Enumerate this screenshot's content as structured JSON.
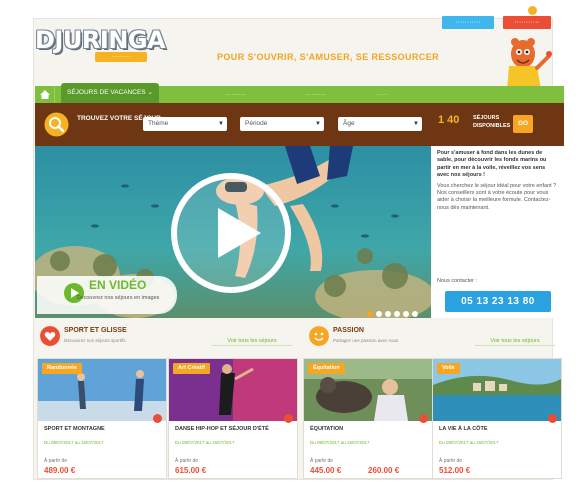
{
  "header": {
    "btn_blue": "···········",
    "btn_red": "···········",
    "logo_main": "DJURINGA",
    "logo_tag": "·········",
    "slogan": "POUR S'OUVRIR, S'AMUSER, SE RESSOURCER"
  },
  "nav": {
    "items": [
      "SÉJOURS DE VACANCES ⌄",
      "··········",
      "··········",
      "······"
    ]
  },
  "search": {
    "label": "TROUVEZ VOTRE SÉJOUR",
    "selects": [
      "Thème",
      "Période",
      "Âge"
    ],
    "count": "1 40",
    "count_label": "SÉJOURS DISPONIBLES",
    "go": "GO"
  },
  "hero": {
    "video_title": "EN VIDÉO",
    "video_sub": "Découvrez nos séjours en images",
    "side_lead": "Pour s'amuser à fond dans les dunes de sable, pour découvrir les fonds marins ou partir en mer à la voile, réveillez vos sens avec nos séjours !",
    "side_text": "Vous cherchez le séjour idéal pour votre enfant ? Nos conseillers sont à votre écoute pour vous aider à choisir la meilleure formule. Contactez-nous dès maintenant.",
    "phone_label": "Nous contacter :",
    "phone": "05 13 23 13 80"
  },
  "sections": [
    {
      "title": "SPORT ET GLISSE",
      "subtitle": "Découvrez nos séjours sportifs"
    },
    {
      "title": "PASSION",
      "subtitle": "Partagez une passion avec nous"
    }
  ],
  "section_links": [
    "Voir tous les séjours",
    "Voir tous les séjours"
  ],
  "cards": [
    {
      "tag": "Randonnée",
      "title": "SPORT ET MONTAGNE",
      "subtitle": "Du 09/07/2017 au 16/07/2017",
      "from": "À partir de",
      "price": "489.00 €",
      "price2": ""
    },
    {
      "tag": "Art Créatif",
      "title": "DANSE HIP-HOP ET SÉJOUR D'ÉTÉ",
      "subtitle": "Du 09/07/2017 au 15/07/2017",
      "from": "À partir de",
      "price": "615.00 €",
      "price2": ""
    },
    {
      "tag": "Équitation",
      "title": "ÉQUITATION",
      "subtitle": "Du 09/07/2017 au 15/07/2017",
      "from": "À partir de",
      "price": "445.00 €",
      "price2": "260.00 €"
    },
    {
      "tag": "Voile",
      "title": "LA VIE À LA CÔTE",
      "subtitle": "Du 09/07/2017 au 15/07/2017",
      "from": "À partir de",
      "price": "512.00 €",
      "price2": ""
    }
  ],
  "colors": {
    "green_nav": "#7fbf3f",
    "brown_search": "#6e3612",
    "accent_orange": "#f6a623",
    "accent_blue": "#2aa3e0",
    "accent_red": "#ec4e35"
  }
}
